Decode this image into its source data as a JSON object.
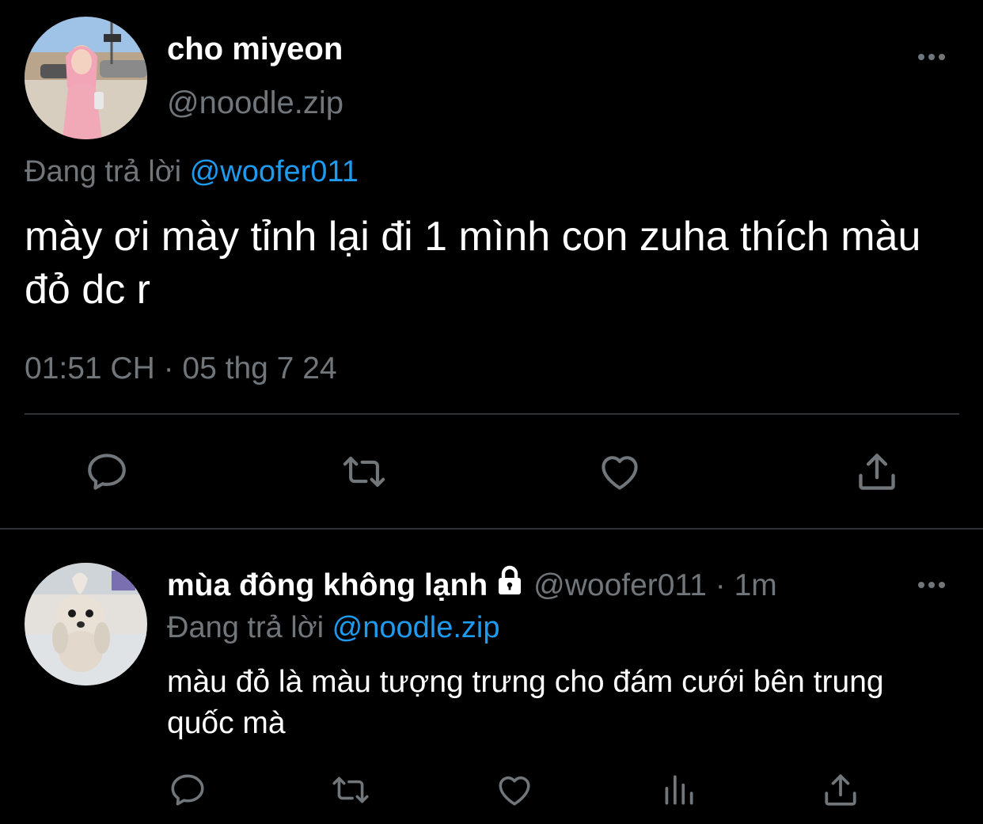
{
  "colors": {
    "background": "#000000",
    "text_primary": "#ffffff",
    "text_secondary": "#71767b",
    "accent": "#1d9bf0",
    "divider": "#2f3336"
  },
  "main_tweet": {
    "display_name": "cho miyeon",
    "handle": "@noodle.zip",
    "replying_prefix": "Đang trả lời",
    "replying_to": "@woofer011",
    "text": "mày ơi mày tỉnh lại đi 1 mình con zuha thích màu đỏ dc r",
    "timestamp": "01:51 CH · 05 thg 7 24",
    "more_icon": "more-horizontal-icon",
    "actions": [
      "reply-icon",
      "retweet-icon",
      "like-icon",
      "share-icon"
    ]
  },
  "reply_tweet": {
    "display_name": "mùa đông không lạnh",
    "protected_icon": "lock-icon",
    "meta": "@woofer011 · 1m",
    "replying_prefix": "Đang trả lời",
    "replying_to": "@noodle.zip",
    "text": "màu đỏ là màu tượng trưng cho đám cưới bên trung quốc mà",
    "more_icon": "more-horizontal-icon",
    "actions": [
      "reply-icon",
      "retweet-icon",
      "like-icon",
      "analytics-icon",
      "share-icon"
    ]
  }
}
